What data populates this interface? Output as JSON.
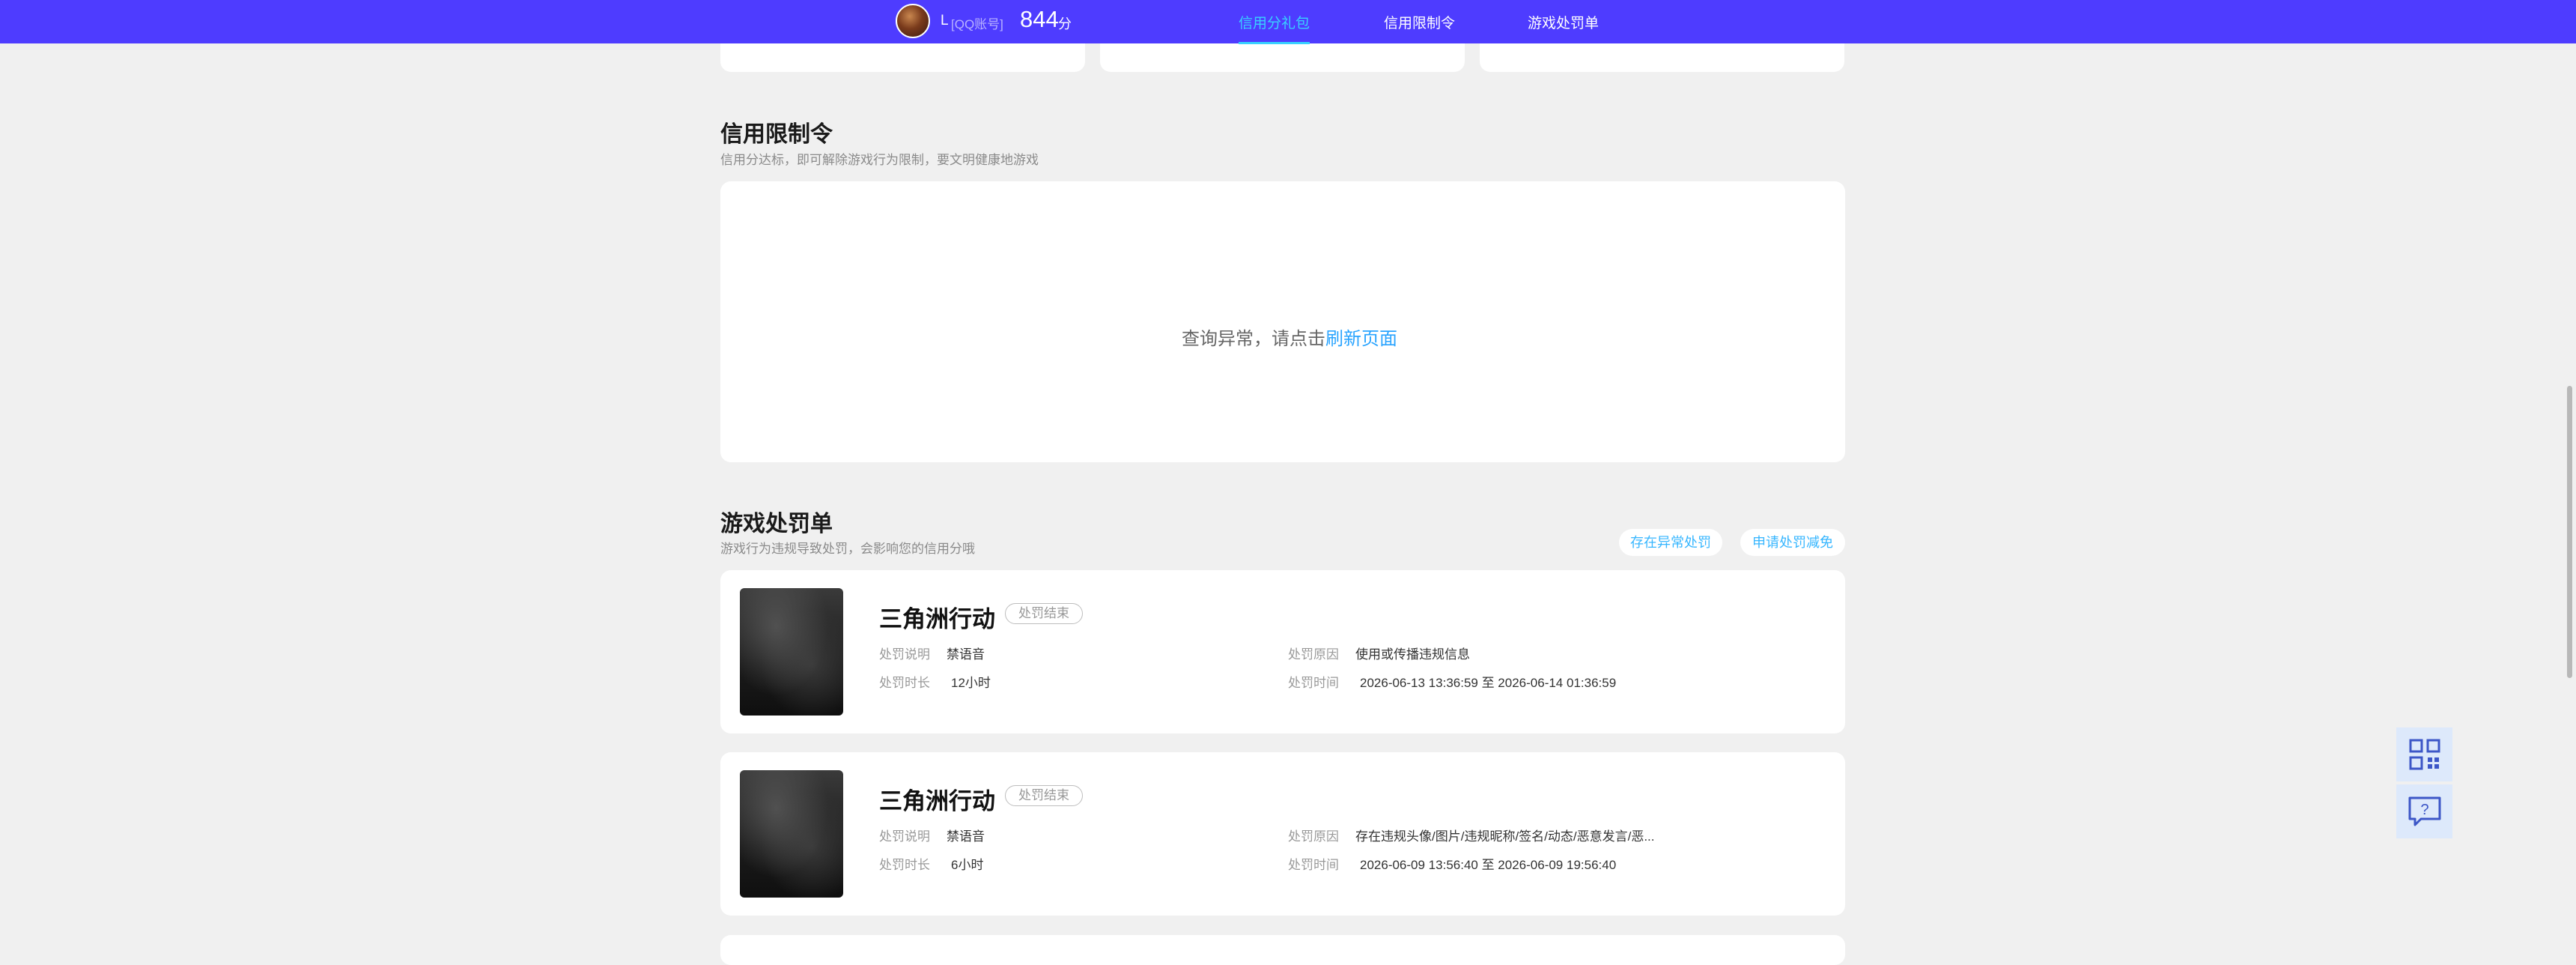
{
  "header": {
    "user_name": "L",
    "account_type": "[QQ账号]",
    "score": "844",
    "score_unit": "分",
    "tabs": [
      {
        "label": "信用分礼包",
        "active": true
      },
      {
        "label": "信用限制令",
        "active": false
      },
      {
        "label": "游戏处罚单",
        "active": false
      }
    ]
  },
  "restriction": {
    "title": "信用限制令",
    "desc": "信用分达标，即可解除游戏行为限制，要文明健康地游戏",
    "empty_text": "查询异常，请点击",
    "refresh_link": "刷新页面"
  },
  "penalty": {
    "title": "游戏处罚单",
    "desc": "游戏行为违规导致处罚，会影响您的信用分哦",
    "btn_abnormal": "存在异常处罚",
    "btn_reduce": "申请处罚减免",
    "labels": {
      "explain": "处罚说明",
      "duration": "处罚时长",
      "reason": "处罚原因",
      "time": "处罚时间"
    },
    "records": [
      {
        "game": "三角洲行动",
        "status": "处罚结束",
        "explain": "禁语音",
        "duration": "12小时",
        "reason": "使用或传播违规信息",
        "time": "2026-06-13 13:36:59 至 2026-06-14 01:36:59"
      },
      {
        "game": "三角洲行动",
        "status": "处罚结束",
        "explain": "禁语音",
        "duration": "6小时",
        "reason": "存在违规头像/图片/违规昵称/签名/动态/恶意发言/恶...",
        "time": "2026-06-09 13:56:40 至 2026-06-09 19:56:40"
      }
    ]
  },
  "colors": {
    "nav_bg": "#4e3cff",
    "accent": "#38d2ff",
    "link": "#2aa4ff",
    "page_bg": "#f0f0f0"
  },
  "icons": {
    "float_top": "qr-code-icon",
    "float_bottom": "help-chat-icon"
  }
}
